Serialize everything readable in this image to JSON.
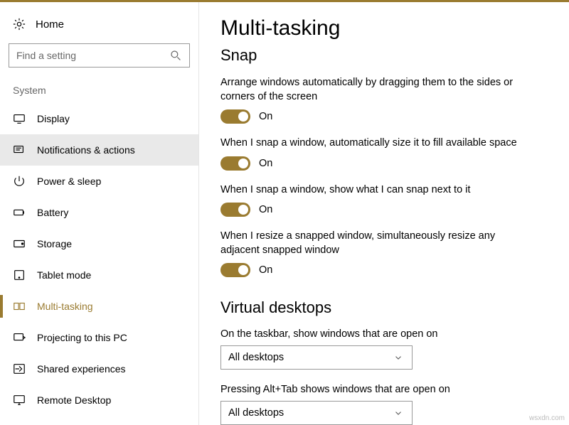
{
  "sidebar": {
    "home": "Home",
    "search_placeholder": "Find a setting",
    "section": "System",
    "items": [
      {
        "label": "Display"
      },
      {
        "label": "Notifications & actions"
      },
      {
        "label": "Power & sleep"
      },
      {
        "label": "Battery"
      },
      {
        "label": "Storage"
      },
      {
        "label": "Tablet mode"
      },
      {
        "label": "Multi-tasking"
      },
      {
        "label": "Projecting to this PC"
      },
      {
        "label": "Shared experiences"
      },
      {
        "label": "Remote Desktop"
      }
    ]
  },
  "main": {
    "title": "Multi-tasking",
    "snap_title": "Snap",
    "snap": [
      {
        "text": "Arrange windows automatically by dragging them to the sides or corners of the screen",
        "state": "On"
      },
      {
        "text": "When I snap a window, automatically size it to fill available space",
        "state": "On"
      },
      {
        "text": "When I snap a window, show what I can snap next to it",
        "state": "On"
      },
      {
        "text": "When I resize a snapped window, simultaneously resize any adjacent snapped window",
        "state": "On"
      }
    ],
    "vd_title": "Virtual desktops",
    "vd": [
      {
        "label": "On the taskbar, show windows that are open on",
        "value": "All desktops"
      },
      {
        "label": "Pressing Alt+Tab shows windows that are open on",
        "value": "All desktops"
      }
    ]
  },
  "watermark": "wsxdn.com"
}
